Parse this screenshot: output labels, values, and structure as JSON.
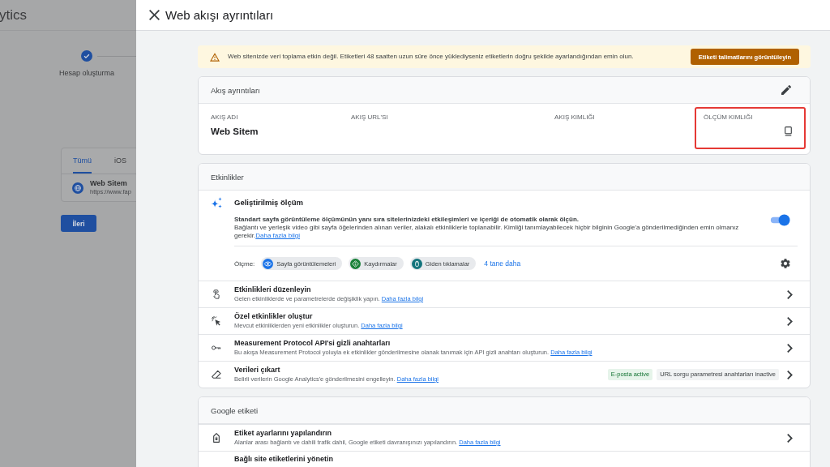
{
  "background_page": {
    "title_fragment": "ytics",
    "steps": [
      {
        "label": "Hesap oluşturma",
        "done": true
      }
    ],
    "tabs": [
      {
        "label": "Tümü",
        "selected": true
      },
      {
        "label": "iOS",
        "selected": false
      }
    ],
    "streams": [
      {
        "name": "Web Sitem",
        "url": "https://www.fap"
      }
    ],
    "next_button": "İleri"
  },
  "panel": {
    "title": "Web akışı ayrıntıları",
    "alert": {
      "message": "Web sitenizde veri toplama etkin değil. Etiketleri 48 saatten uzun süre önce yüklediyseniz etiketlerin doğru şekilde ayarlandığından emin olun.",
      "button": "Etiketi talimatlarını görüntüleyin"
    },
    "stream_details": {
      "title": "Akış ayrıntıları",
      "columns": [
        {
          "label": "AKIŞ ADI",
          "value": "Web Sitem",
          "kind": "plain",
          "highlighted": false
        },
        {
          "label": "AKIŞ URL'SI",
          "kind": "plain",
          "highlighted": false
        },
        {
          "label": "AKIŞ KIMLIĞI",
          "kind": "plain",
          "highlighted": false
        },
        {
          "label": "ÖLÇÜM KIMLIĞI",
          "kind": "copyable",
          "highlighted": true
        }
      ]
    },
    "events": {
      "title": "Etkinlikler",
      "enhanced_measurement": {
        "title": "Geliştirilmiş ölçüm",
        "summary": "Standart sayfa görüntüleme ölçümünün yanı sıra sitelerinizdeki etkileşimleri ve içeriği de otomatik olarak ölçün.",
        "detail": "Bağlantı ve yerleşik video gibi sayfa öğelerinden alınan veriler, alakalı etkinliklerle toplanabilir. Kimliği tanımlayabilecek hiçbir bilginin Google'a gönderilmediğinden emin olmanız gerekir.",
        "link": "Daha fazla bilgi",
        "on": true,
        "measure_label": "Ölçme:",
        "chips": [
          {
            "label": "Sayfa görüntülemeleri",
            "color": "#1a73e8"
          },
          {
            "label": "Kaydırmalar",
            "color": "#188038"
          },
          {
            "label": "Giden tıklamalar",
            "color": "#12737c"
          }
        ],
        "more_link": "4 tane daha"
      },
      "rows": [
        {
          "title": "Etkinlikleri düzenleyin",
          "description": "Gelen etkinliklerde ve parametrelerde değişiklik yapın.",
          "link": "Daha fazla bilgi"
        },
        {
          "title": "Özel etkinlikler oluştur",
          "description": "Mevcut etkinliklerden yeni etkinlikler oluşturun.",
          "link": "Daha fazla bilgi"
        },
        {
          "title": "Measurement Protocol API'si gizli anahtarları",
          "description": "Bu akışa Measurement Protocol yoluyla ek etkinlikler gönderilmesine olanak tanımak için API gizli anahtarı oluşturun.",
          "link": "Daha fazla bilgi"
        },
        {
          "title": "Verileri çıkart",
          "description": "Belirli verilerin Google Analytics'e gönderilmesini engelleyin.",
          "link": "Daha fazla bilgi",
          "badges": [
            {
              "label": "E-posta active",
              "active": true
            },
            {
              "label": "URL sorgu parametresi anahtarları inactive",
              "active": false
            }
          ]
        }
      ]
    },
    "google_tag": {
      "title": "Google etiketi",
      "rows": [
        {
          "title": "Etiket ayarlarını yapılandırın",
          "description": "Alanlar arası bağlantı ve dahili trafik dahil, Google etiketi davranışınızı yapılandırın.",
          "link": "Daha fazla bilgi"
        },
        {
          "title": "Bağlı site etiketlerini yönetin"
        }
      ]
    }
  }
}
